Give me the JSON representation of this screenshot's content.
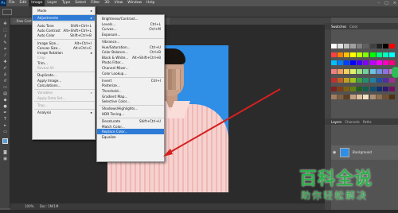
{
  "menubar": {
    "logo": "Ps",
    "items": [
      "File",
      "Edit",
      "Image",
      "Layer",
      "Type",
      "Select",
      "Filter",
      "3D",
      "View",
      "Window",
      "Help"
    ],
    "active": "Image"
  },
  "document_tab": "...Raw Content...",
  "status": {
    "zoom": "100%",
    "doc": "Doc: 1M/1M"
  },
  "right_panels": {
    "swatches_tabs": [
      "Swatches",
      "Color"
    ],
    "layers_tabs": [
      "Layers",
      "Channels",
      "Paths"
    ],
    "layer_name": "Background"
  },
  "image_menu": {
    "items": [
      {
        "label": "Mode",
        "shortcut": "",
        "submenu": true,
        "disabled": false
      },
      {
        "sep": true
      },
      {
        "label": "Adjustments",
        "shortcut": "",
        "submenu": true,
        "highlight": true
      },
      {
        "sep": true
      },
      {
        "label": "Auto Tone",
        "shortcut": "Shift+Ctrl+L"
      },
      {
        "label": "Auto Contrast",
        "shortcut": "Alt+Shift+Ctrl+L"
      },
      {
        "label": "Auto Color",
        "shortcut": "Shift+Ctrl+B"
      },
      {
        "sep": true
      },
      {
        "label": "Image Size...",
        "shortcut": "Alt+Ctrl+I"
      },
      {
        "label": "Canvas Size...",
        "shortcut": "Alt+Ctrl+C"
      },
      {
        "label": "Image Rotation",
        "submenu": true
      },
      {
        "label": "Crop",
        "disabled": true
      },
      {
        "label": "Trim..."
      },
      {
        "label": "Reveal All",
        "disabled": true
      },
      {
        "sep": true
      },
      {
        "label": "Duplicate..."
      },
      {
        "label": "Apply Image..."
      },
      {
        "label": "Calculations..."
      },
      {
        "sep": true
      },
      {
        "label": "Variables",
        "submenu": true,
        "disabled": true
      },
      {
        "label": "Apply Data Set...",
        "disabled": true
      },
      {
        "sep": true
      },
      {
        "label": "Trap...",
        "disabled": true
      },
      {
        "sep": true
      },
      {
        "label": "Analysis",
        "submenu": true
      }
    ]
  },
  "adjustments_menu": {
    "items": [
      {
        "label": "Brightness/Contrast..."
      },
      {
        "label": "Levels...",
        "shortcut": "Ctrl+L"
      },
      {
        "label": "Curves...",
        "shortcut": "Ctrl+M"
      },
      {
        "label": "Exposure..."
      },
      {
        "sep": true
      },
      {
        "label": "Vibrance..."
      },
      {
        "label": "Hue/Saturation...",
        "shortcut": "Ctrl+U"
      },
      {
        "label": "Color Balance...",
        "shortcut": "Ctrl+B"
      },
      {
        "label": "Black & White...",
        "shortcut": "Alt+Shift+Ctrl+B"
      },
      {
        "label": "Photo Filter..."
      },
      {
        "label": "Channel Mixer..."
      },
      {
        "label": "Color Lookup..."
      },
      {
        "sep": true
      },
      {
        "label": "Invert",
        "shortcut": "Ctrl+I"
      },
      {
        "label": "Posterize..."
      },
      {
        "label": "Threshold..."
      },
      {
        "label": "Gradient Map..."
      },
      {
        "label": "Selective Color..."
      },
      {
        "sep": true
      },
      {
        "label": "Shadows/Highlights..."
      },
      {
        "label": "HDR Toning..."
      },
      {
        "sep": true
      },
      {
        "label": "Desaturate",
        "shortcut": "Shift+Ctrl+U"
      },
      {
        "label": "Match Color..."
      },
      {
        "label": "Replace Color...",
        "highlight": true
      },
      {
        "label": "Equalize"
      }
    ]
  },
  "watermark": {
    "title": "百科全说",
    "subtitle": "助你轻松解决"
  },
  "colors": {
    "highlight": "#2e7bd6",
    "photo_bg": "#2f8ee6",
    "watermark": "#2fae4a",
    "arrow": "#d42020"
  }
}
